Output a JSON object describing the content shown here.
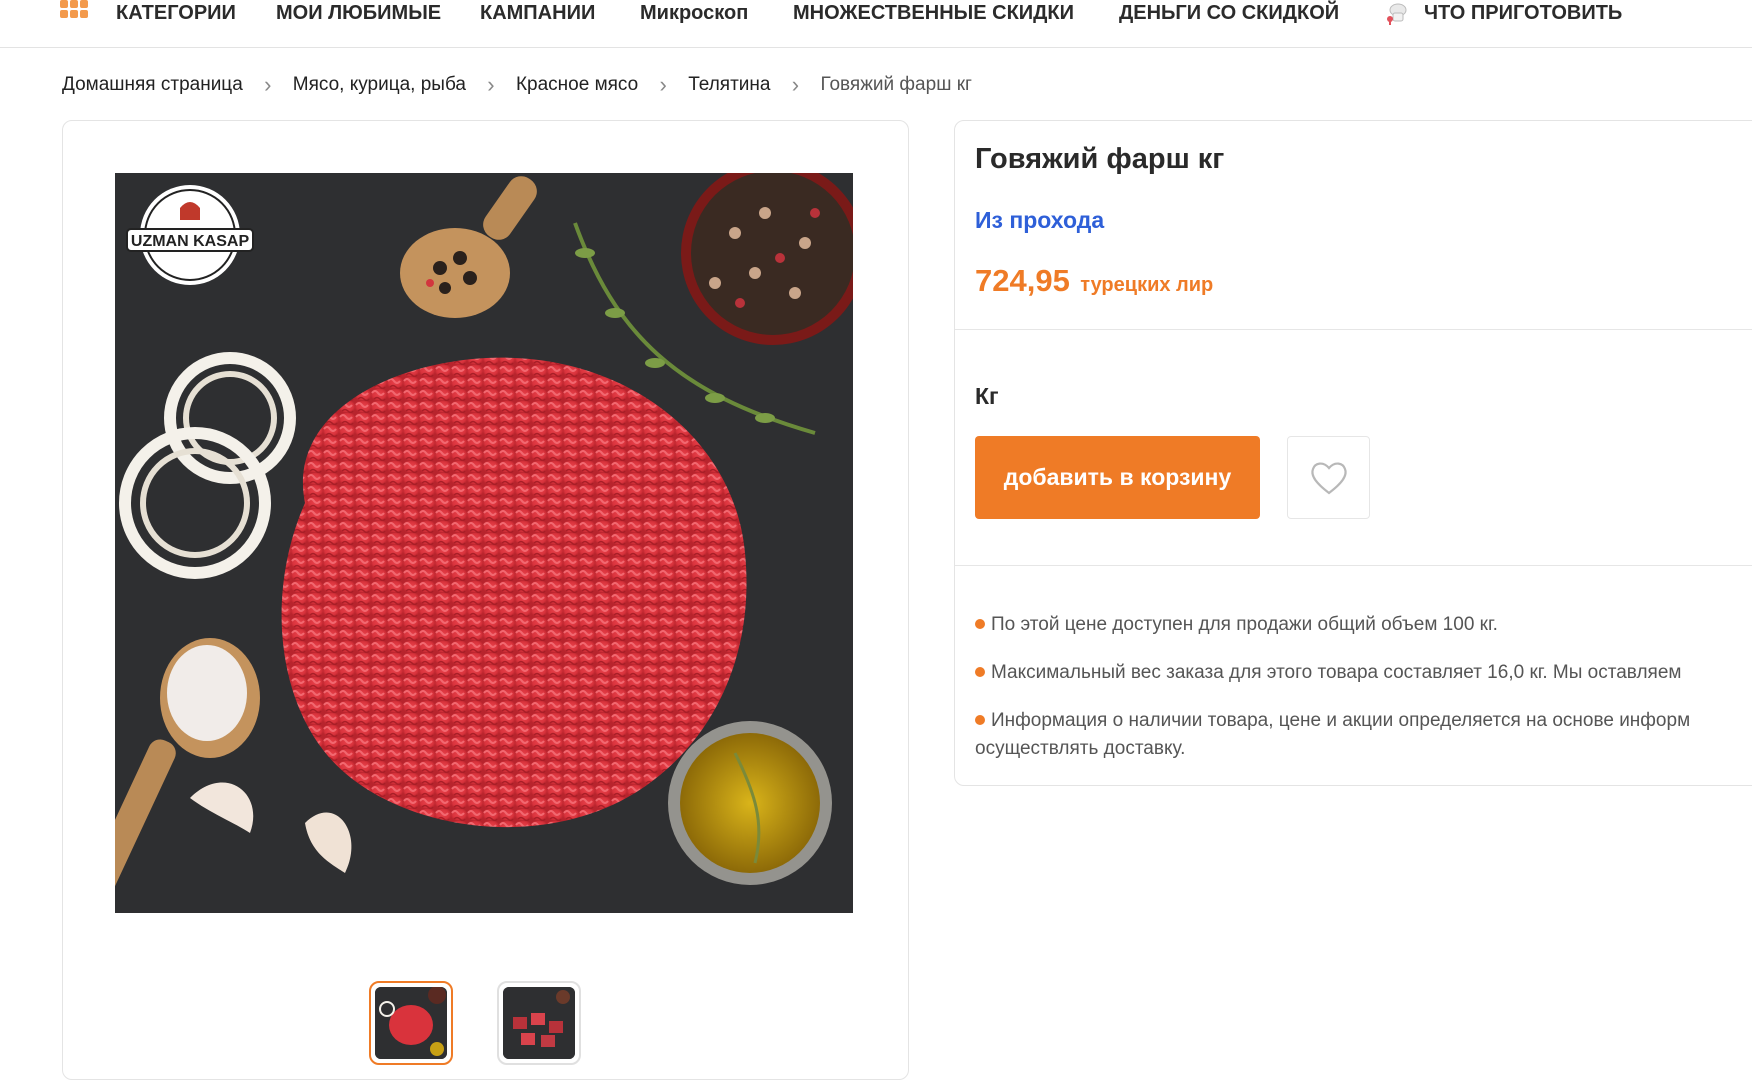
{
  "nav": {
    "items": [
      "КАТЕГОРИИ",
      "МОИ ЛЮБИМЫЕ",
      "КАМПАНИИ",
      "Микроскоп",
      "МНОЖЕСТВЕННЫЕ СКИДКИ",
      "ДЕНЬГИ СО СКИДКОЙ",
      "ЧТО ПРИГОТОВИТЬ"
    ],
    "accent": "#f39a4c"
  },
  "breadcrumb": [
    "Домашняя страница",
    "Мясо, курица, рыба",
    "Красное мясо",
    "Телятина",
    "Говяжий фарш кг"
  ],
  "gallery": {
    "logo_text": "UZMAN KASAP",
    "thumbnails": [
      "minced-beef",
      "diced-beef"
    ],
    "active_thumb": 0
  },
  "product": {
    "title": "Говяжий фарш кг",
    "seller": "Из прохода",
    "price": "724,95",
    "currency": "турецких лир",
    "unit": "Кг",
    "add_to_cart": "добавить в корзину",
    "favorite_icon": "heart-icon",
    "notes": [
      "По этой цене доступен для продажи общий объем 100 кг.",
      "Максимальный вес заказа для этого товара составляет 16,0 кг. Мы оставляем",
      "Информация о наличии товара, цене и акции определяется на основе информ"
    ],
    "note3_cont": "осуществлять доставку."
  },
  "colors": {
    "brand": "#ef7b26",
    "seller": "#2e5fd8"
  }
}
